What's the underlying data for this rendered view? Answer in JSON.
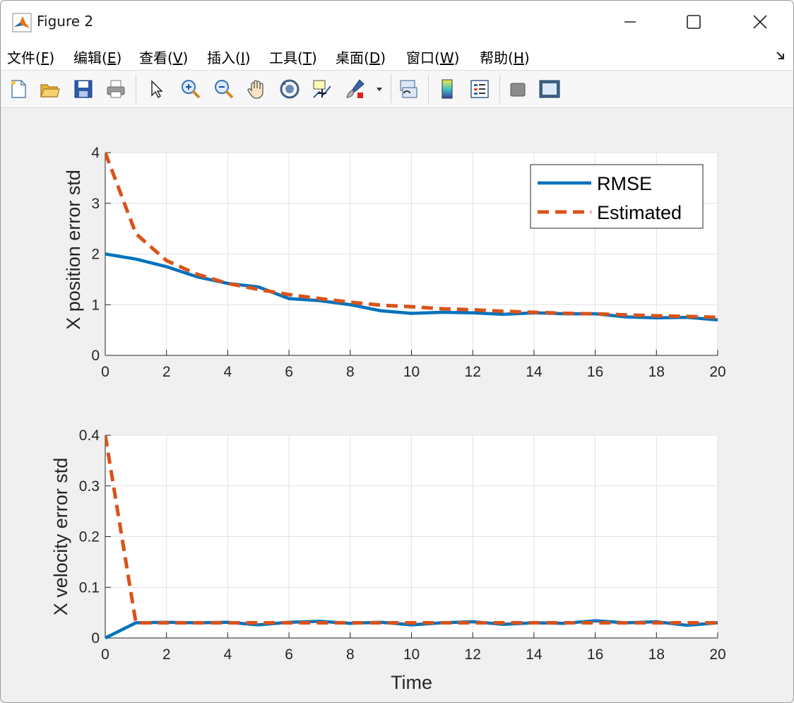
{
  "window": {
    "title": "Figure 2"
  },
  "menu": {
    "items": [
      {
        "label": "文件",
        "key": "F"
      },
      {
        "label": "编辑",
        "key": "E"
      },
      {
        "label": "查看",
        "key": "V"
      },
      {
        "label": "插入",
        "key": "I"
      },
      {
        "label": "工具",
        "key": "T"
      },
      {
        "label": "桌面",
        "key": "D"
      },
      {
        "label": "窗口",
        "key": "W"
      },
      {
        "label": "帮助",
        "key": "H"
      }
    ]
  },
  "toolbar": {
    "icons": [
      "new-figure-icon",
      "open-file-icon",
      "save-icon",
      "print-icon",
      "pointer-icon",
      "zoom-in-icon",
      "zoom-out-icon",
      "pan-hand-icon",
      "rotate-3d-icon",
      "data-cursor-icon",
      "brush-icon",
      "link-plot-icon",
      "colorbar-icon",
      "legend-icon",
      "hide-plot-tools-icon",
      "show-plot-tools-icon"
    ]
  },
  "colors": {
    "rmse": "#0072BD",
    "estimated": "#D95319",
    "grid": "#e2e2e2"
  },
  "chart_data": [
    {
      "type": "line",
      "title": "",
      "xlabel": "",
      "ylabel": "X position error std",
      "xlim": [
        0,
        20
      ],
      "ylim": [
        0,
        4
      ],
      "xticks": [
        "0",
        "2",
        "4",
        "6",
        "8",
        "10",
        "12",
        "14",
        "16",
        "18",
        "20"
      ],
      "yticks": [
        "0",
        "1",
        "2",
        "3",
        "4"
      ],
      "grid": true,
      "legend": {
        "placement": "top-right",
        "entries": [
          "RMSE",
          "Estimated"
        ]
      },
      "x": [
        0,
        1,
        2,
        3,
        4,
        5,
        6,
        7,
        8,
        9,
        10,
        11,
        12,
        13,
        14,
        15,
        16,
        17,
        18,
        19,
        20
      ],
      "series": [
        {
          "name": "RMSE",
          "style": "solid",
          "values": [
            2.0,
            1.9,
            1.75,
            1.55,
            1.42,
            1.35,
            1.12,
            1.08,
            1.0,
            0.88,
            0.83,
            0.85,
            0.84,
            0.81,
            0.84,
            0.82,
            0.82,
            0.76,
            0.74,
            0.75,
            0.7
          ]
        },
        {
          "name": "Estimated",
          "style": "dashed",
          "values": [
            4.0,
            2.4,
            1.87,
            1.6,
            1.42,
            1.3,
            1.2,
            1.12,
            1.05,
            0.99,
            0.96,
            0.92,
            0.9,
            0.87,
            0.85,
            0.83,
            0.82,
            0.8,
            0.78,
            0.77,
            0.75
          ]
        }
      ]
    },
    {
      "type": "line",
      "title": "",
      "xlabel": "Time",
      "ylabel": "X velocity error std",
      "xlim": [
        0,
        20
      ],
      "ylim": [
        0,
        0.4
      ],
      "xticks": [
        "0",
        "2",
        "4",
        "6",
        "8",
        "10",
        "12",
        "14",
        "16",
        "18",
        "20"
      ],
      "yticks": [
        "0",
        "0.1",
        "0.2",
        "0.3",
        "0.4"
      ],
      "grid": true,
      "x": [
        0,
        1,
        2,
        3,
        4,
        5,
        6,
        7,
        8,
        9,
        10,
        11,
        12,
        13,
        14,
        15,
        16,
        17,
        18,
        19,
        20
      ],
      "series": [
        {
          "name": "RMSE",
          "style": "solid",
          "values": [
            0.0,
            0.03,
            0.031,
            0.03,
            0.031,
            0.026,
            0.031,
            0.033,
            0.029,
            0.031,
            0.026,
            0.03,
            0.032,
            0.027,
            0.03,
            0.029,
            0.034,
            0.03,
            0.032,
            0.025,
            0.03
          ]
        },
        {
          "name": "Estimated",
          "style": "dashed",
          "values": [
            0.4,
            0.03,
            0.03,
            0.03,
            0.03,
            0.03,
            0.03,
            0.03,
            0.03,
            0.03,
            0.03,
            0.03,
            0.03,
            0.03,
            0.03,
            0.03,
            0.03,
            0.03,
            0.03,
            0.03,
            0.03
          ]
        }
      ]
    }
  ]
}
